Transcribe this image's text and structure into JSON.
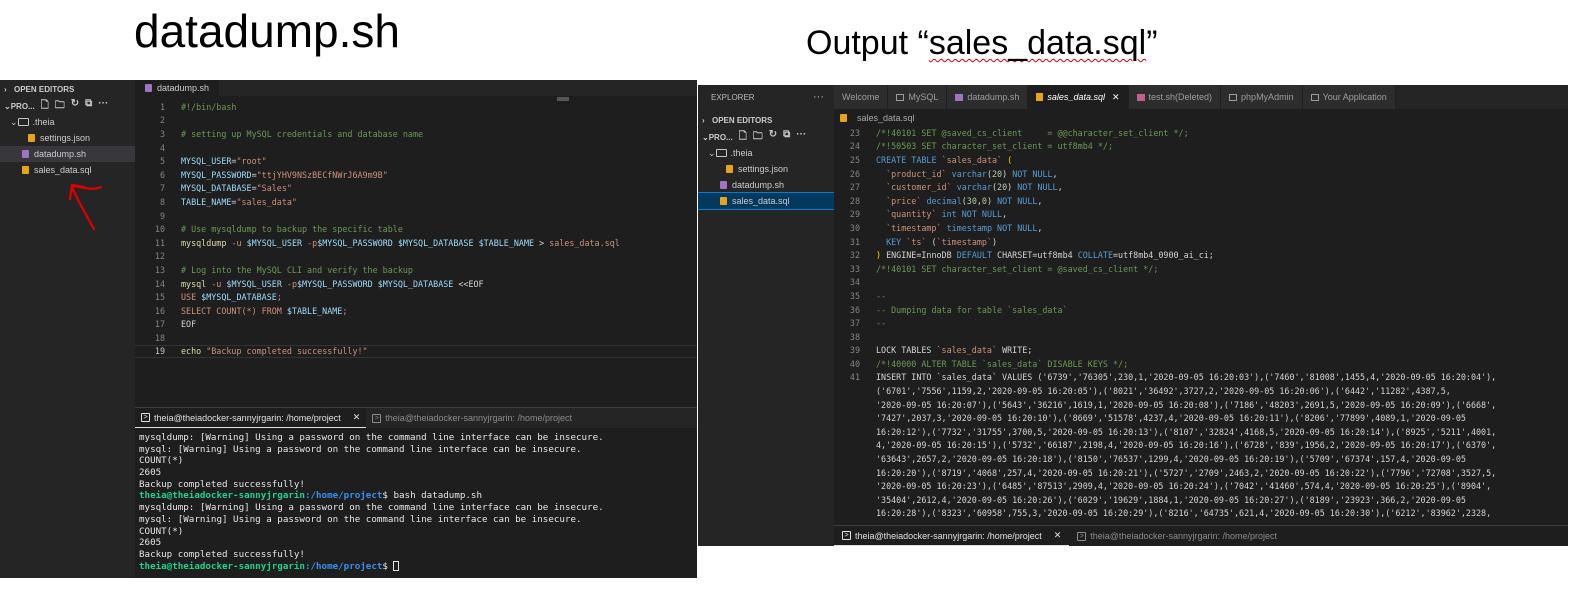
{
  "captions": {
    "left": "datadump.sh",
    "right_prefix": "Output “",
    "right_file": "sales_data.sql",
    "right_suffix": "”"
  },
  "left_ide": {
    "sidebar": {
      "open_editors": "OPEN EDITORS",
      "project": "PRO...",
      "items": [
        {
          "label": ".theia",
          "type": "folder"
        },
        {
          "label": "settings.json",
          "type": "json"
        },
        {
          "label": "datadump.sh",
          "type": "sh"
        },
        {
          "label": "sales_data.sql",
          "type": "sql"
        }
      ]
    },
    "tab": "datadump.sh",
    "code": [
      {
        "n": "1",
        "parts": [
          [
            "c-com",
            "#!/bin/bash"
          ]
        ]
      },
      {
        "n": "2",
        "parts": []
      },
      {
        "n": "3",
        "parts": [
          [
            "c-com",
            "# setting up MySQL credentials and database name"
          ]
        ]
      },
      {
        "n": "4",
        "parts": []
      },
      {
        "n": "5",
        "parts": [
          [
            "c-var",
            "MYSQL_USER"
          ],
          [
            "c-txt",
            "="
          ],
          [
            "c-str",
            "\"root\""
          ]
        ]
      },
      {
        "n": "6",
        "parts": [
          [
            "c-var",
            "MYSQL_PASSWORD"
          ],
          [
            "c-txt",
            "="
          ],
          [
            "c-str",
            "\"ttjYHV9NSzBECfNWrJ6A9m9B\""
          ]
        ]
      },
      {
        "n": "7",
        "parts": [
          [
            "c-var",
            "MYSQL_DATABASE"
          ],
          [
            "c-txt",
            "="
          ],
          [
            "c-str",
            "\"Sales\""
          ]
        ]
      },
      {
        "n": "8",
        "parts": [
          [
            "c-var",
            "TABLE_NAME"
          ],
          [
            "c-txt",
            "="
          ],
          [
            "c-str",
            "\"sales_data\""
          ]
        ]
      },
      {
        "n": "9",
        "parts": []
      },
      {
        "n": "10",
        "parts": [
          [
            "c-com",
            "# Use mysqldump to backup the specific table"
          ]
        ]
      },
      {
        "n": "11",
        "parts": [
          [
            "c-fn",
            "mysqldump"
          ],
          [
            "c-txt",
            " "
          ],
          [
            "c-str",
            "-u"
          ],
          [
            "c-txt",
            " "
          ],
          [
            "c-var",
            "$MYSQL_USER"
          ],
          [
            "c-txt",
            " "
          ],
          [
            "c-str",
            "-p"
          ],
          [
            "c-var",
            "$MYSQL_PASSWORD"
          ],
          [
            "c-txt",
            " "
          ],
          [
            "c-var",
            "$MYSQL_DATABASE"
          ],
          [
            "c-txt",
            " "
          ],
          [
            "c-var",
            "$TABLE_NAME"
          ],
          [
            "c-txt",
            " > "
          ],
          [
            "c-str",
            "sales_data.sql"
          ]
        ]
      },
      {
        "n": "12",
        "parts": []
      },
      {
        "n": "13",
        "parts": [
          [
            "c-com",
            "# Log into the MySQL CLI and verify the backup"
          ]
        ]
      },
      {
        "n": "14",
        "parts": [
          [
            "c-fn",
            "mysql"
          ],
          [
            "c-txt",
            " "
          ],
          [
            "c-str",
            "-u"
          ],
          [
            "c-txt",
            " "
          ],
          [
            "c-var",
            "$MYSQL_USER"
          ],
          [
            "c-txt",
            " "
          ],
          [
            "c-str",
            "-p"
          ],
          [
            "c-var",
            "$MYSQL_PASSWORD"
          ],
          [
            "c-txt",
            " "
          ],
          [
            "c-var",
            "$MYSQL_DATABASE"
          ],
          [
            "c-txt",
            " <<EOF"
          ]
        ]
      },
      {
        "n": "15",
        "parts": [
          [
            "c-str",
            "USE "
          ],
          [
            "c-var",
            "$MYSQL_DATABASE"
          ],
          [
            "c-str",
            ";"
          ]
        ]
      },
      {
        "n": "16",
        "parts": [
          [
            "c-str",
            "SELECT COUNT(*) FROM "
          ],
          [
            "c-var",
            "$TABLE_NAME"
          ],
          [
            "c-str",
            ";"
          ]
        ]
      },
      {
        "n": "17",
        "parts": [
          [
            "c-txt",
            "EOF"
          ]
        ]
      },
      {
        "n": "18",
        "parts": []
      },
      {
        "n": "19",
        "parts": [
          [
            "c-fn",
            "echo"
          ],
          [
            "c-txt",
            " "
          ],
          [
            "c-str",
            "\"Backup completed successfully!\""
          ]
        ]
      }
    ],
    "terminal": {
      "tabs": [
        "theia@theiadocker-sannyjrgarin: /home/project",
        "theia@theiadocker-sannyjrgarin: /home/project"
      ],
      "lines": [
        {
          "t": "mysqldump: [Warning] Using a password on the command line interface can be insecure."
        },
        {
          "t": "mysql: [Warning] Using a password on the command line interface can be insecure."
        },
        {
          "t": "COUNT(*)"
        },
        {
          "t": "2605"
        },
        {
          "t": "Backup completed successfully!"
        },
        {
          "user": "theia@theiadocker-sannyjrgarin",
          "path": ":/home/project",
          "cmd": "$ bash datadump.sh"
        },
        {
          "t": "mysqldump: [Warning] Using a password on the command line interface can be insecure."
        },
        {
          "t": "mysql: [Warning] Using a password on the command line interface can be insecure."
        },
        {
          "t": "COUNT(*)"
        },
        {
          "t": "2605"
        },
        {
          "t": "Backup completed successfully!"
        },
        {
          "user": "theia@theiadocker-sannyjrgarin",
          "path": ":/home/project",
          "cmd": "$ ",
          "cursor": true
        }
      ]
    }
  },
  "right_ide": {
    "sidebar": {
      "title": "EXPLORER",
      "more": "···",
      "open_editors": "OPEN EDITORS",
      "project": "PRO...",
      "items": [
        {
          "label": ".theia",
          "type": "folder"
        },
        {
          "label": "settings.json",
          "type": "json"
        },
        {
          "label": "datadump.sh",
          "type": "sh"
        },
        {
          "label": "sales_data.sql",
          "type": "sql"
        }
      ]
    },
    "tabs": [
      {
        "label": "Welcome",
        "icon": "none"
      },
      {
        "label": "MySQL",
        "icon": "sq"
      },
      {
        "label": "datadump.sh",
        "icon": "sh"
      },
      {
        "label": "sales_data.sql",
        "icon": "sql",
        "active": true
      },
      {
        "label": "test.sh(Deleted)",
        "icon": "deleted"
      },
      {
        "label": "phpMyAdmin",
        "icon": "sq"
      },
      {
        "label": "Your Application",
        "icon": "sq"
      }
    ],
    "breadcrumb": "sales_data.sql",
    "code": [
      {
        "n": "23",
        "parts": [
          [
            "c-com",
            "/*!40101 SET @saved_cs_client     = @@character_set_client */;"
          ]
        ]
      },
      {
        "n": "24",
        "parts": [
          [
            "c-com",
            "/*!50503 SET character_set_client = utf8mb4 */;"
          ]
        ]
      },
      {
        "n": "25",
        "parts": [
          [
            "c-kw",
            "CREATE TABLE"
          ],
          [
            "c-txt",
            " "
          ],
          [
            "c-bt",
            "`sales_data`"
          ],
          [
            "c-txt",
            " "
          ],
          [
            "c-paren",
            "("
          ]
        ]
      },
      {
        "n": "26",
        "parts": [
          [
            "c-txt",
            "  "
          ],
          [
            "c-bt",
            "`product_id`"
          ],
          [
            "c-txt",
            " "
          ],
          [
            "c-kw",
            "varchar"
          ],
          [
            "c-txt",
            "("
          ],
          [
            "c-num",
            "20"
          ],
          [
            "c-txt",
            ") "
          ],
          [
            "c-kw",
            "NOT NULL"
          ],
          [
            "c-txt",
            ","
          ]
        ]
      },
      {
        "n": "27",
        "parts": [
          [
            "c-txt",
            "  "
          ],
          [
            "c-bt",
            "`customer_id`"
          ],
          [
            "c-txt",
            " "
          ],
          [
            "c-kw",
            "varchar"
          ],
          [
            "c-txt",
            "("
          ],
          [
            "c-num",
            "20"
          ],
          [
            "c-txt",
            ") "
          ],
          [
            "c-kw",
            "NOT NULL"
          ],
          [
            "c-txt",
            ","
          ]
        ]
      },
      {
        "n": "28",
        "parts": [
          [
            "c-txt",
            "  "
          ],
          [
            "c-bt",
            "`price`"
          ],
          [
            "c-txt",
            " "
          ],
          [
            "c-kw",
            "decimal"
          ],
          [
            "c-txt",
            "("
          ],
          [
            "c-num",
            "30"
          ],
          [
            "c-txt",
            ","
          ],
          [
            "c-num",
            "0"
          ],
          [
            "c-txt",
            ") "
          ],
          [
            "c-kw",
            "NOT NULL"
          ],
          [
            "c-txt",
            ","
          ]
        ]
      },
      {
        "n": "29",
        "parts": [
          [
            "c-txt",
            "  "
          ],
          [
            "c-bt",
            "`quantity`"
          ],
          [
            "c-txt",
            " "
          ],
          [
            "c-kw",
            "int NOT NULL"
          ],
          [
            "c-txt",
            ","
          ]
        ]
      },
      {
        "n": "30",
        "parts": [
          [
            "c-txt",
            "  "
          ],
          [
            "c-bt",
            "`timestamp`"
          ],
          [
            "c-txt",
            " "
          ],
          [
            "c-kw",
            "timestamp NOT NULL"
          ],
          [
            "c-txt",
            ","
          ]
        ]
      },
      {
        "n": "31",
        "parts": [
          [
            "c-txt",
            "  "
          ],
          [
            "c-kw",
            "KEY"
          ],
          [
            "c-txt",
            " "
          ],
          [
            "c-bt",
            "`ts`"
          ],
          [
            "c-txt",
            " ("
          ],
          [
            "c-bt",
            "`timestamp`"
          ],
          [
            "c-txt",
            ")"
          ]
        ]
      },
      {
        "n": "32",
        "parts": [
          [
            "c-paren",
            ")"
          ],
          [
            "c-txt",
            " ENGINE=InnoDB "
          ],
          [
            "c-kw",
            "DEFAULT"
          ],
          [
            "c-txt",
            " CHARSET=utf8mb4 "
          ],
          [
            "c-kw",
            "COLLATE"
          ],
          [
            "c-txt",
            "=utf8mb4_0900_ai_ci;"
          ]
        ]
      },
      {
        "n": "33",
        "parts": [
          [
            "c-com",
            "/*!40101 SET character_set_client = @saved_cs_client */;"
          ]
        ]
      },
      {
        "n": "34",
        "parts": []
      },
      {
        "n": "35",
        "parts": [
          [
            "c-com",
            "--"
          ]
        ]
      },
      {
        "n": "36",
        "parts": [
          [
            "c-com",
            "-- Dumping data for table `sales_data`"
          ]
        ]
      },
      {
        "n": "37",
        "parts": [
          [
            "c-com",
            "--"
          ]
        ]
      },
      {
        "n": "38",
        "parts": []
      },
      {
        "n": "39",
        "parts": [
          [
            "c-txt",
            "LOCK TABLES "
          ],
          [
            "c-bt",
            "`sales_data`"
          ],
          [
            "c-txt",
            " WRITE;"
          ]
        ]
      },
      {
        "n": "40",
        "parts": [
          [
            "c-com",
            "/*!40000 ALTER TABLE `sales_data` DISABLE KEYS */;"
          ]
        ]
      },
      {
        "n": "41",
        "parts": [
          [
            "c-txt",
            "INSERT INTO `sales_data` VALUES ('6739','76305',230,1,'2020-09-05 16:20:03'),('7460','81008',1455,4,'2020-09-05 16:20:04'),"
          ]
        ]
      },
      {
        "n": "",
        "parts": [
          [
            "c-txt",
            "('6701','7556',1159,2,'2020-09-05 16:20:05'),('8021','36492',3727,2,'2020-09-05 16:20:06'),('6442','11282',4387,5,"
          ]
        ]
      },
      {
        "n": "",
        "parts": [
          [
            "c-txt",
            "'2020-09-05 16:20:07'),('5643','36216',1619,1,'2020-09-05 16:20:08'),('7186','48203',2691,5,'2020-09-05 16:20:09'),('6668',"
          ]
        ]
      },
      {
        "n": "",
        "parts": [
          [
            "c-txt",
            "'7427',2037,3,'2020-09-05 16:20:10'),('8669','51578',4237,4,'2020-09-05 16:20:11'),('8206','77899',4089,1,'2020-09-05"
          ]
        ]
      },
      {
        "n": "",
        "parts": [
          [
            "c-txt",
            "16:20:12'),('7732','31755',3700,5,'2020-09-05 16:20:13'),('8107','32824',4168,5,'2020-09-05 16:20:14'),('8925','5211',4001,"
          ]
        ]
      },
      {
        "n": "",
        "parts": [
          [
            "c-txt",
            "4,'2020-09-05 16:20:15'),('5732','66187',2198,4,'2020-09-05 16:20:16'),('6728','839',1956,2,'2020-09-05 16:20:17'),('6370',"
          ]
        ]
      },
      {
        "n": "",
        "parts": [
          [
            "c-txt",
            "'63643',2657,2,'2020-09-05 16:20:18'),('8150','76537',1299,4,'2020-09-05 16:20:19'),('5709','67374',157,4,'2020-09-05"
          ]
        ]
      },
      {
        "n": "",
        "parts": [
          [
            "c-txt",
            "16:20:20'),('8719','4068',257,4,'2020-09-05 16:20:21'),('5727','2709',2463,2,'2020-09-05 16:20:22'),('7796','72708',3527,5,"
          ]
        ]
      },
      {
        "n": "",
        "parts": [
          [
            "c-txt",
            "'2020-09-05 16:20:23'),('6485','87513',2909,4,'2020-09-05 16:20:24'),('7042','41460',574,4,'2020-09-05 16:20:25'),('8904',"
          ]
        ]
      },
      {
        "n": "",
        "parts": [
          [
            "c-txt",
            "'35404',2612,4,'2020-09-05 16:20:26'),('6029','19629',1884,1,'2020-09-05 16:20:27'),('8189','23923',366,2,'2020-09-05"
          ]
        ]
      },
      {
        "n": "",
        "parts": [
          [
            "c-txt",
            "16:20:28'),('8323','60958',755,3,'2020-09-05 16:20:29'),('8216','64735',621,4,'2020-09-05 16:20:30'),('6212','83962',2328,"
          ]
        ]
      }
    ],
    "terminal": {
      "tabs": [
        "theia@theiadocker-sannyjrgarin: /home/project",
        "theia@theiadocker-sannyjrgarin: /home/project"
      ]
    }
  },
  "colors": {
    "annotation_arrow": "#e00000",
    "editor_bg": "#1e1e1e",
    "sidebar_bg": "#252526"
  }
}
